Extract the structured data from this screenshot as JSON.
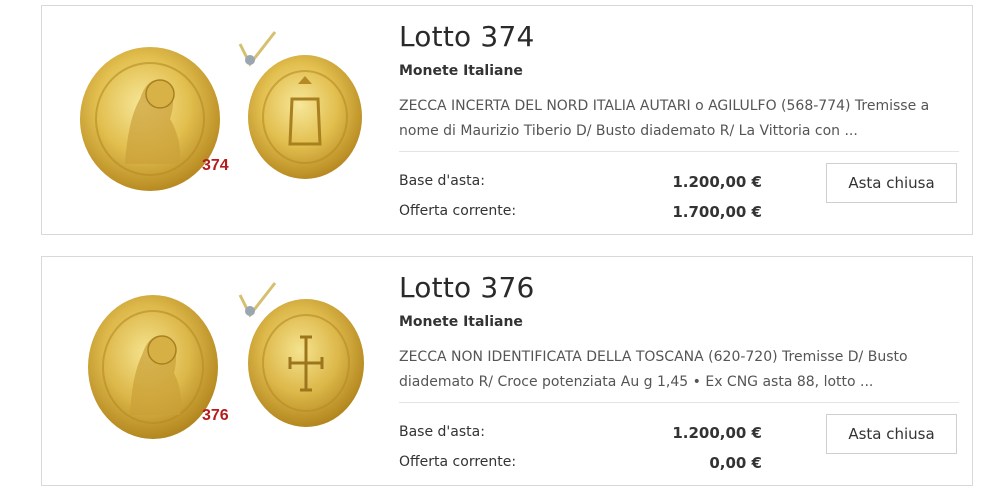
{
  "lots": [
    {
      "title": "Lotto 374",
      "category": "Monete Italiane",
      "description": "ZECCA INCERTA DEL NORD ITALIA AUTARI o AGILULFO (568-774) Tremisse a nome di Maurizio Tiberio D/ Busto diademato R/ La Vittoria con ...",
      "image_label": "374",
      "base_label": "Base d'asta:",
      "base_value": "1.200,00 €",
      "offer_label": "Offerta corrente:",
      "offer_value": "1.700,00 €",
      "button_label": "Asta chiusa"
    },
    {
      "title": "Lotto 376",
      "category": "Monete Italiane",
      "description": "ZECCA NON IDENTIFICATA DELLA TOSCANA (620-720) Tremisse D/ Busto diademato R/ Croce potenziata Au g 1,45 • Ex CNG asta 88, lotto ...",
      "image_label": "376",
      "base_label": "Base d'asta:",
      "base_value": "1.200,00 €",
      "offer_label": "Offerta corrente:",
      "offer_value": "0,00 €",
      "button_label": "Asta chiusa"
    }
  ],
  "colors": {
    "gold_light": "#f2dc7a",
    "gold_mid": "#d9b443",
    "gold_dark": "#a67e1c",
    "lot_number_red": "#b51d1d",
    "border": "#d9d9d9"
  }
}
